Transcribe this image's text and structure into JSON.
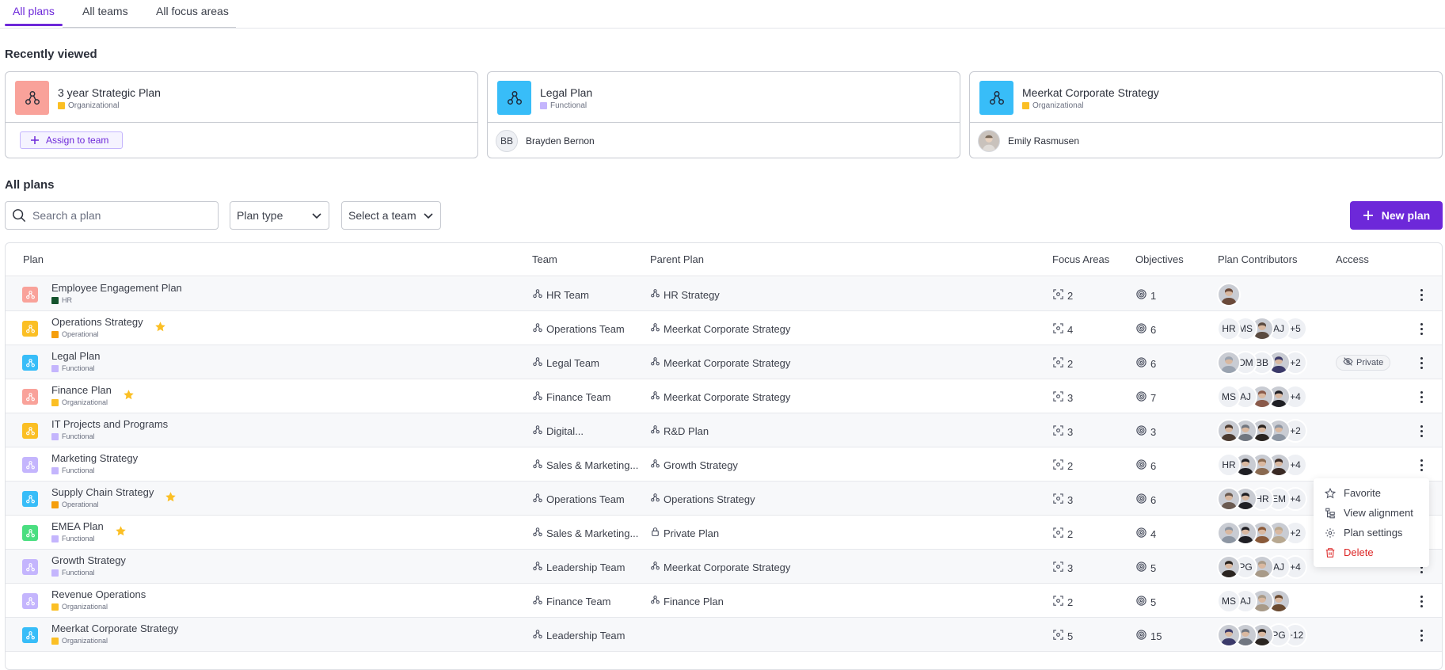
{
  "tabs": [
    {
      "label": "All plans",
      "active": true
    },
    {
      "label": "All teams",
      "active": false
    },
    {
      "label": "All focus areas",
      "active": false
    }
  ],
  "recent": {
    "title": "Recently viewed",
    "cards": [
      {
        "name": "3 year Strategic Plan",
        "type": "Organizational",
        "icon_color": "#f9a29a",
        "type_color": "#fbbf24",
        "action_label": "Assign to team"
      },
      {
        "name": "Legal Plan",
        "type": "Functional",
        "icon_color": "#38bdf8",
        "type_color": "#c4b5fd",
        "owner_initials": "BB",
        "owner_name": "Brayden Bernon"
      },
      {
        "name": "Meerkat Corporate Strategy",
        "type": "Organizational",
        "icon_color": "#38bdf8",
        "type_color": "#fbbf24",
        "owner_name": "Emily Rasmusen"
      }
    ]
  },
  "all_plans": {
    "title": "All plans",
    "search_placeholder": "Search a plan",
    "plan_type_label": "Plan type",
    "team_label": "Select a team",
    "new_plan_label": "New plan"
  },
  "table": {
    "headers": {
      "plan": "Plan",
      "team": "Team",
      "parent": "Parent Plan",
      "focus": "Focus Areas",
      "objectives": "Objectives",
      "contributors": "Plan Contributors",
      "access": "Access"
    },
    "rows": [
      {
        "name": "Employee Engagement Plan",
        "type": "HR",
        "type_color": "#14532d",
        "icon_color": "#f9a29a",
        "fav": false,
        "team": "HR Team",
        "parent": "HR Strategy",
        "parent_icon": "plan",
        "focus": "2",
        "objectives": "1",
        "contribs": [
          {
            "kind": "photo",
            "tone": "#6b4a3a"
          }
        ]
      },
      {
        "name": "Operations Strategy",
        "type": "Operational",
        "type_color": "#f59e0b",
        "icon_color": "#fbbf24",
        "fav": true,
        "team": "Operations Team",
        "parent": "Meerkat Corporate Strategy",
        "parent_icon": "plan",
        "focus": "4",
        "objectives": "6",
        "contribs": [
          {
            "kind": "initials",
            "text": "HR"
          },
          {
            "kind": "initials",
            "text": "MS"
          },
          {
            "kind": "photo",
            "tone": "#5a4a40"
          },
          {
            "kind": "initials",
            "text": "AJ"
          },
          {
            "kind": "more",
            "text": "+5"
          }
        ]
      },
      {
        "name": "Legal Plan",
        "type": "Functional",
        "type_color": "#c4b5fd",
        "icon_color": "#38bdf8",
        "fav": false,
        "team": "Legal Team",
        "parent": "Meerkat Corporate Strategy",
        "parent_icon": "plan",
        "focus": "2",
        "objectives": "6",
        "access": "Private",
        "contribs": [
          {
            "kind": "photo",
            "tone": "#9aa3b0"
          },
          {
            "kind": "initials",
            "text": "OM"
          },
          {
            "kind": "initials",
            "text": "BB"
          },
          {
            "kind": "photo",
            "tone": "#3b3a6a"
          },
          {
            "kind": "more",
            "text": "+2"
          }
        ]
      },
      {
        "name": "Finance Plan",
        "type": "Organizational",
        "type_color": "#fbbf24",
        "icon_color": "#f9a29a",
        "fav": true,
        "team": "Finance Team",
        "parent": "Meerkat Corporate Strategy",
        "parent_icon": "plan",
        "focus": "3",
        "objectives": "7",
        "contribs": [
          {
            "kind": "initials",
            "text": "MS"
          },
          {
            "kind": "initials",
            "text": "AJ"
          },
          {
            "kind": "photo",
            "tone": "#8a5a4a"
          },
          {
            "kind": "photo",
            "tone": "#1f1f24"
          },
          {
            "kind": "more",
            "text": "+4"
          }
        ]
      },
      {
        "name": "IT Projects and Programs",
        "type": "Functional",
        "type_color": "#c4b5fd",
        "icon_color": "#fbbf24",
        "fav": false,
        "team": "Digital...",
        "parent": "R&D Plan",
        "parent_icon": "plan",
        "focus": "3",
        "objectives": "3",
        "contribs": [
          {
            "kind": "photo",
            "tone": "#4a3a30"
          },
          {
            "kind": "photo",
            "tone": "#707680"
          },
          {
            "kind": "photo",
            "tone": "#2a2420"
          },
          {
            "kind": "photo",
            "tone": "#8d96a3"
          },
          {
            "kind": "more",
            "text": "+2"
          }
        ]
      },
      {
        "name": "Marketing Strategy",
        "type": "Functional",
        "type_color": "#c4b5fd",
        "icon_color": "#c4b5fd",
        "fav": false,
        "team": "Sales & Marketing...",
        "parent": "Growth Strategy",
        "parent_icon": "plan",
        "focus": "2",
        "objectives": "6",
        "contribs": [
          {
            "kind": "initials",
            "text": "HR"
          },
          {
            "kind": "photo",
            "tone": "#1f1f24"
          },
          {
            "kind": "photo",
            "tone": "#8a6a50"
          },
          {
            "kind": "photo",
            "tone": "#3a2a24"
          },
          {
            "kind": "more",
            "text": "+4"
          }
        ]
      },
      {
        "name": "Supply Chain Strategy",
        "type": "Operational",
        "type_color": "#f59e0b",
        "icon_color": "#38bdf8",
        "fav": true,
        "team": "Operations Team",
        "parent": "Operations Strategy",
        "parent_icon": "plan",
        "focus": "3",
        "objectives": "6",
        "contribs": [
          {
            "kind": "photo",
            "tone": "#6a5a50"
          },
          {
            "kind": "photo",
            "tone": "#1f1f24"
          },
          {
            "kind": "initials",
            "text": "HR"
          },
          {
            "kind": "initials",
            "text": "EM"
          },
          {
            "kind": "more",
            "text": "+4"
          }
        ]
      },
      {
        "name": "EMEA Plan",
        "type": "Functional",
        "type_color": "#c4b5fd",
        "icon_color": "#4ade80",
        "fav": true,
        "team": "Sales & Marketing...",
        "parent": "Private Plan",
        "parent_icon": "lock",
        "focus": "2",
        "objectives": "4",
        "contribs": [
          {
            "kind": "photo",
            "tone": "#8d96a3"
          },
          {
            "kind": "photo",
            "tone": "#1f1f24"
          },
          {
            "kind": "photo",
            "tone": "#8a5a3a"
          },
          {
            "kind": "photo",
            "tone": "#b8a890"
          },
          {
            "kind": "more",
            "text": "+2"
          }
        ]
      },
      {
        "name": "Growth Strategy",
        "type": "Functional",
        "type_color": "#c4b5fd",
        "icon_color": "#c4b5fd",
        "fav": false,
        "team": "Leadership Team",
        "parent": "Meerkat Corporate Strategy",
        "parent_icon": "plan",
        "focus": "3",
        "objectives": "5",
        "contribs": [
          {
            "kind": "photo",
            "tone": "#2a2420"
          },
          {
            "kind": "initials",
            "text": "PG"
          },
          {
            "kind": "photo",
            "tone": "#a89a88"
          },
          {
            "kind": "initials",
            "text": "AJ"
          },
          {
            "kind": "more",
            "text": "+4"
          }
        ]
      },
      {
        "name": "Revenue Operations",
        "type": "Organizational",
        "type_color": "#fbbf24",
        "icon_color": "#c4b5fd",
        "fav": false,
        "team": "Finance Team",
        "parent": "Finance Plan",
        "parent_icon": "plan",
        "focus": "2",
        "objectives": "5",
        "contribs": [
          {
            "kind": "initials",
            "text": "MS"
          },
          {
            "kind": "initials",
            "text": "AJ"
          },
          {
            "kind": "photo",
            "tone": "#a89a88"
          },
          {
            "kind": "photo",
            "tone": "#6a4a30"
          }
        ]
      },
      {
        "name": "Meerkat Corporate Strategy",
        "type": "Organizational",
        "type_color": "#fbbf24",
        "icon_color": "#38bdf8",
        "fav": false,
        "team": "Leadership Team",
        "parent": "",
        "parent_icon": "none",
        "focus": "5",
        "objectives": "15",
        "contribs": [
          {
            "kind": "photo",
            "tone": "#3b3a6a"
          },
          {
            "kind": "photo",
            "tone": "#707680"
          },
          {
            "kind": "photo",
            "tone": "#2a2420"
          },
          {
            "kind": "initials",
            "text": "PG"
          },
          {
            "kind": "more",
            "text": "+12"
          }
        ]
      }
    ]
  },
  "context_menu": {
    "items": [
      {
        "label": "Favorite",
        "icon": "star-outline-icon"
      },
      {
        "label": "View alignment",
        "icon": "alignment-icon"
      },
      {
        "label": "Plan settings",
        "icon": "gear-icon"
      },
      {
        "label": "Delete",
        "icon": "trash-icon",
        "danger": true
      }
    ]
  },
  "colors": {
    "accent": "#6d28d9",
    "star": "#fbbf24",
    "danger": "#dc2626"
  }
}
